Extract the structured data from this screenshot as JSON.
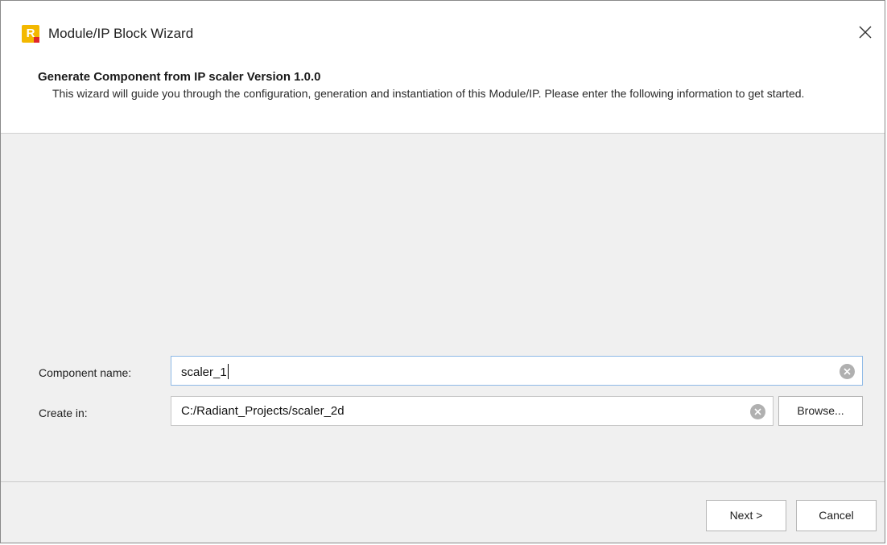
{
  "window": {
    "title": "Module/IP Block Wizard"
  },
  "header": {
    "title": "Generate Component from IP scaler Version 1.0.0",
    "description": "This wizard will guide you through the configuration, generation and instantiation of this Module/IP. Please enter the following information to get started."
  },
  "form": {
    "component_name_label": "Component name:",
    "component_name_value": "scaler_1",
    "create_in_label": "Create in:",
    "create_in_value": "C:/Radiant_Projects/scaler_2d",
    "browse_label": "Browse..."
  },
  "footer": {
    "next_label": "Next >",
    "cancel_label": "Cancel"
  },
  "icons": {
    "app": "radiant-app-icon",
    "close": "close-icon",
    "clear": "clear-icon"
  },
  "colors": {
    "app_icon_yellow": "#f3b800",
    "app_icon_red": "#e0262a",
    "focus_border": "#8db9e6"
  }
}
